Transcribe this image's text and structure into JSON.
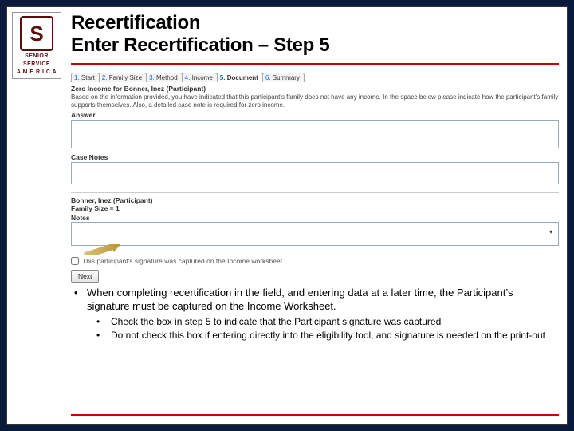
{
  "logo": {
    "glyph": "S",
    "line1": "SENIOR",
    "line2": "SERVICE",
    "line3": "A M E R I C A"
  },
  "title": {
    "line1": "Recertification",
    "line2": "Enter Recertification – Step 5"
  },
  "tabs": [
    {
      "num": "1.",
      "label": "Start"
    },
    {
      "num": "2.",
      "label": "Family Size"
    },
    {
      "num": "3.",
      "label": "Method"
    },
    {
      "num": "4.",
      "label": "Income"
    },
    {
      "num": "5.",
      "label": "Document"
    },
    {
      "num": "6.",
      "label": "Summary"
    }
  ],
  "zeroInc": {
    "title": "Zero Income for Bonner, Inez (Participant)",
    "desc": "Based on the information provided, you have indicated that this participant's family does not have any income. In the space below please indicate how the participant's family supports themselves. Also, a detailed case note is required for zero income.",
    "answerLabel": "Answer"
  },
  "caseNotesLabel": "Case Notes",
  "participantLine": "Bonner, Inez (Participant)",
  "familySizeLine": "Family Size = 1",
  "notesLabel": "Notes",
  "sigCheckboxLabel": "This participant's signature was captured on the Income worksheet",
  "nextLabel": "Next",
  "bullets": {
    "main": "When completing recertification in the field, and entering data at a later time, the Participant’s signature must be captured on the Income Worksheet.",
    "sub1": "Check the box in step 5 to indicate that the Participant signature was captured",
    "sub2": "Do not check this box if entering directly into the eligibility tool, and signature is needed on the print-out"
  }
}
